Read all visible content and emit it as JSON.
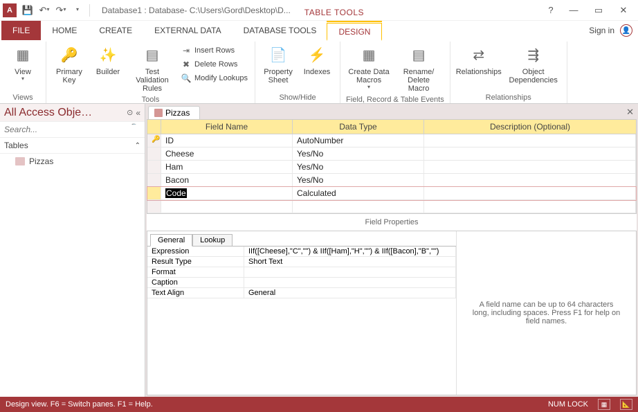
{
  "title": "Database1 : Database- C:\\Users\\Gord\\Desktop\\D...",
  "tabletools_label": "TABLE TOOLS",
  "signin": "Sign in",
  "tabs": {
    "file": "FILE",
    "home": "HOME",
    "create": "CREATE",
    "external": "EXTERNAL DATA",
    "dbtools": "DATABASE TOOLS",
    "design": "DESIGN"
  },
  "ribbon": {
    "views": {
      "view": "View",
      "group": "Views"
    },
    "tools": {
      "primary_key": "Primary Key",
      "builder": "Builder",
      "test_validation": "Test Validation Rules",
      "insert_rows": "Insert Rows",
      "delete_rows": "Delete Rows",
      "modify_lookups": "Modify Lookups",
      "group": "Tools"
    },
    "showhide": {
      "property_sheet": "Property Sheet",
      "indexes": "Indexes",
      "group": "Show/Hide"
    },
    "events": {
      "create_data_macros": "Create Data Macros",
      "rename_delete": "Rename/ Delete Macro",
      "group": "Field, Record & Table Events"
    },
    "relationships": {
      "relationships": "Relationships",
      "object_deps": "Object Dependencies",
      "group": "Relationships"
    }
  },
  "nav": {
    "header": "All Access Obje…",
    "search_placeholder": "Search...",
    "tables_group": "Tables",
    "items": [
      "Pizzas"
    ]
  },
  "doc": {
    "tab": "Pizzas"
  },
  "grid": {
    "h_field": "Field Name",
    "h_type": "Data Type",
    "h_desc": "Description (Optional)",
    "rows": [
      {
        "key": true,
        "name": "ID",
        "type": "AutoNumber"
      },
      {
        "name": "Cheese",
        "type": "Yes/No"
      },
      {
        "name": "Ham",
        "type": "Yes/No"
      },
      {
        "name": "Bacon",
        "type": "Yes/No"
      },
      {
        "sel": true,
        "name": "Code",
        "type": "Calculated"
      }
    ]
  },
  "fp_label": "Field Properties",
  "prop_tabs": {
    "general": "General",
    "lookup": "Lookup"
  },
  "props": {
    "expression_k": "Expression",
    "expression_v": "IIf([Cheese],\"C\",\"\") & IIf([Ham],\"H\",\"\") & IIf([Bacon],\"B\",\"\")",
    "result_type_k": "Result Type",
    "result_type_v": "Short Text",
    "format_k": "Format",
    "format_v": "",
    "caption_k": "Caption",
    "caption_v": "",
    "text_align_k": "Text Align",
    "text_align_v": "General"
  },
  "help_text": "A field name can be up to 64 characters long, including spaces. Press F1 for help on field names.",
  "status": {
    "left": "Design view.  F6 = Switch panes.  F1 = Help.",
    "numlock": "NUM LOCK"
  }
}
